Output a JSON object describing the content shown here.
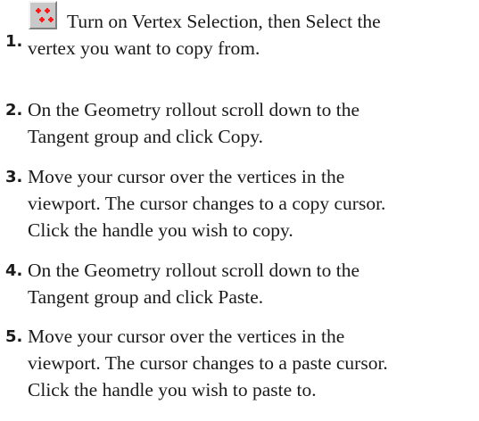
{
  "steps": [
    {
      "number": "1.",
      "lines": [
        "Turn on Vertex Selection, then Select the",
        "vertex you want to copy from."
      ],
      "icon": "vertex-selection-icon"
    },
    {
      "number": "2.",
      "lines": [
        "On the Geometry rollout scroll down to the",
        "Tangent group and click Copy."
      ]
    },
    {
      "number": "3.",
      "lines": [
        "Move your cursor over the vertices in the",
        "viewport. The cursor changes to a copy cursor.",
        "Click the handle you wish to copy."
      ]
    },
    {
      "number": "4.",
      "lines": [
        "On the Geometry rollout scroll down to the",
        "Tangent group and click Paste."
      ]
    },
    {
      "number": "5.",
      "lines": [
        "Move your cursor over the vertices in the",
        "viewport. The cursor changes to a paste cursor.",
        "Click the handle you wish to paste to."
      ]
    }
  ],
  "colors": {
    "text": "#1a1a1a",
    "icon_face": "#c8c8c8",
    "icon_dots": "#ff1a1a"
  }
}
